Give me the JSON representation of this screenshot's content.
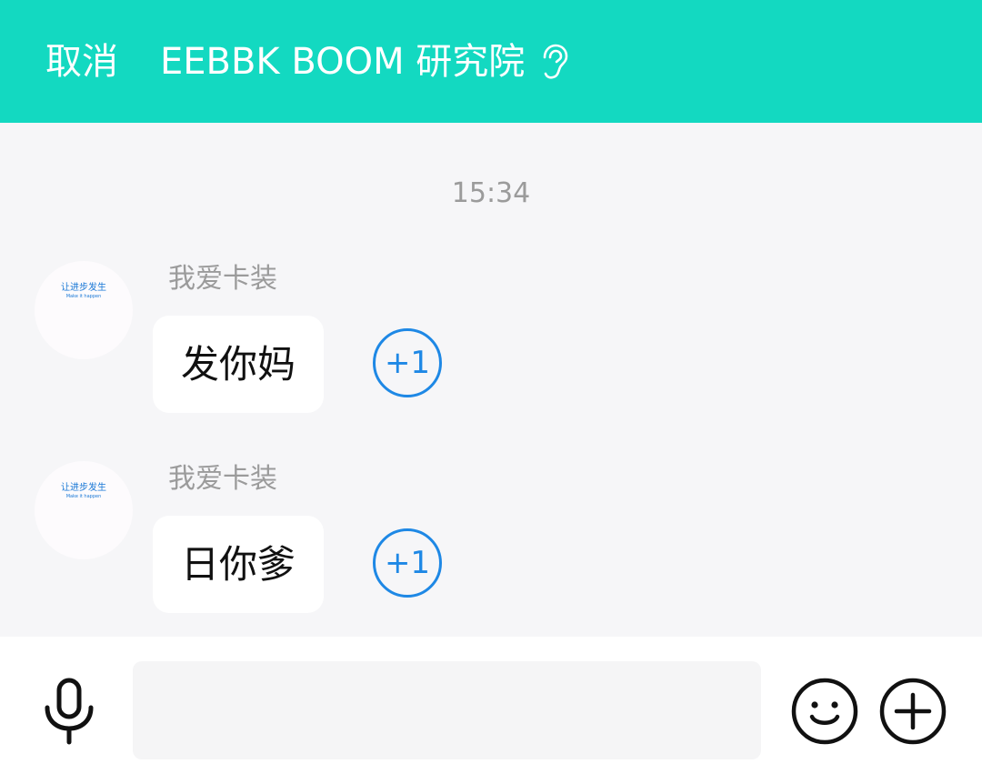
{
  "header": {
    "cancel_label": "取消",
    "title": "EEBBK BOOM 研究院",
    "icon": "ear-icon",
    "background": "#13d9c1"
  },
  "conversation": {
    "timestamp": "15:34",
    "messages": [
      {
        "sender": "我爱卡装",
        "text": "发你妈",
        "avatar_text": "让进步发生",
        "avatar_subtext": "Make it happen",
        "reaction_label": "+1"
      },
      {
        "sender": "我爱卡装",
        "text": "日你爹",
        "avatar_text": "让进步发生",
        "avatar_subtext": "Make it happen",
        "reaction_label": "+1"
      }
    ]
  },
  "composer": {
    "input_value": "",
    "icons": [
      "microphone-icon",
      "emoji-icon",
      "plus-icon"
    ]
  },
  "colors": {
    "accent": "#13d9c1",
    "reaction": "#1e88e5",
    "muted_text": "#9b9b9b"
  }
}
